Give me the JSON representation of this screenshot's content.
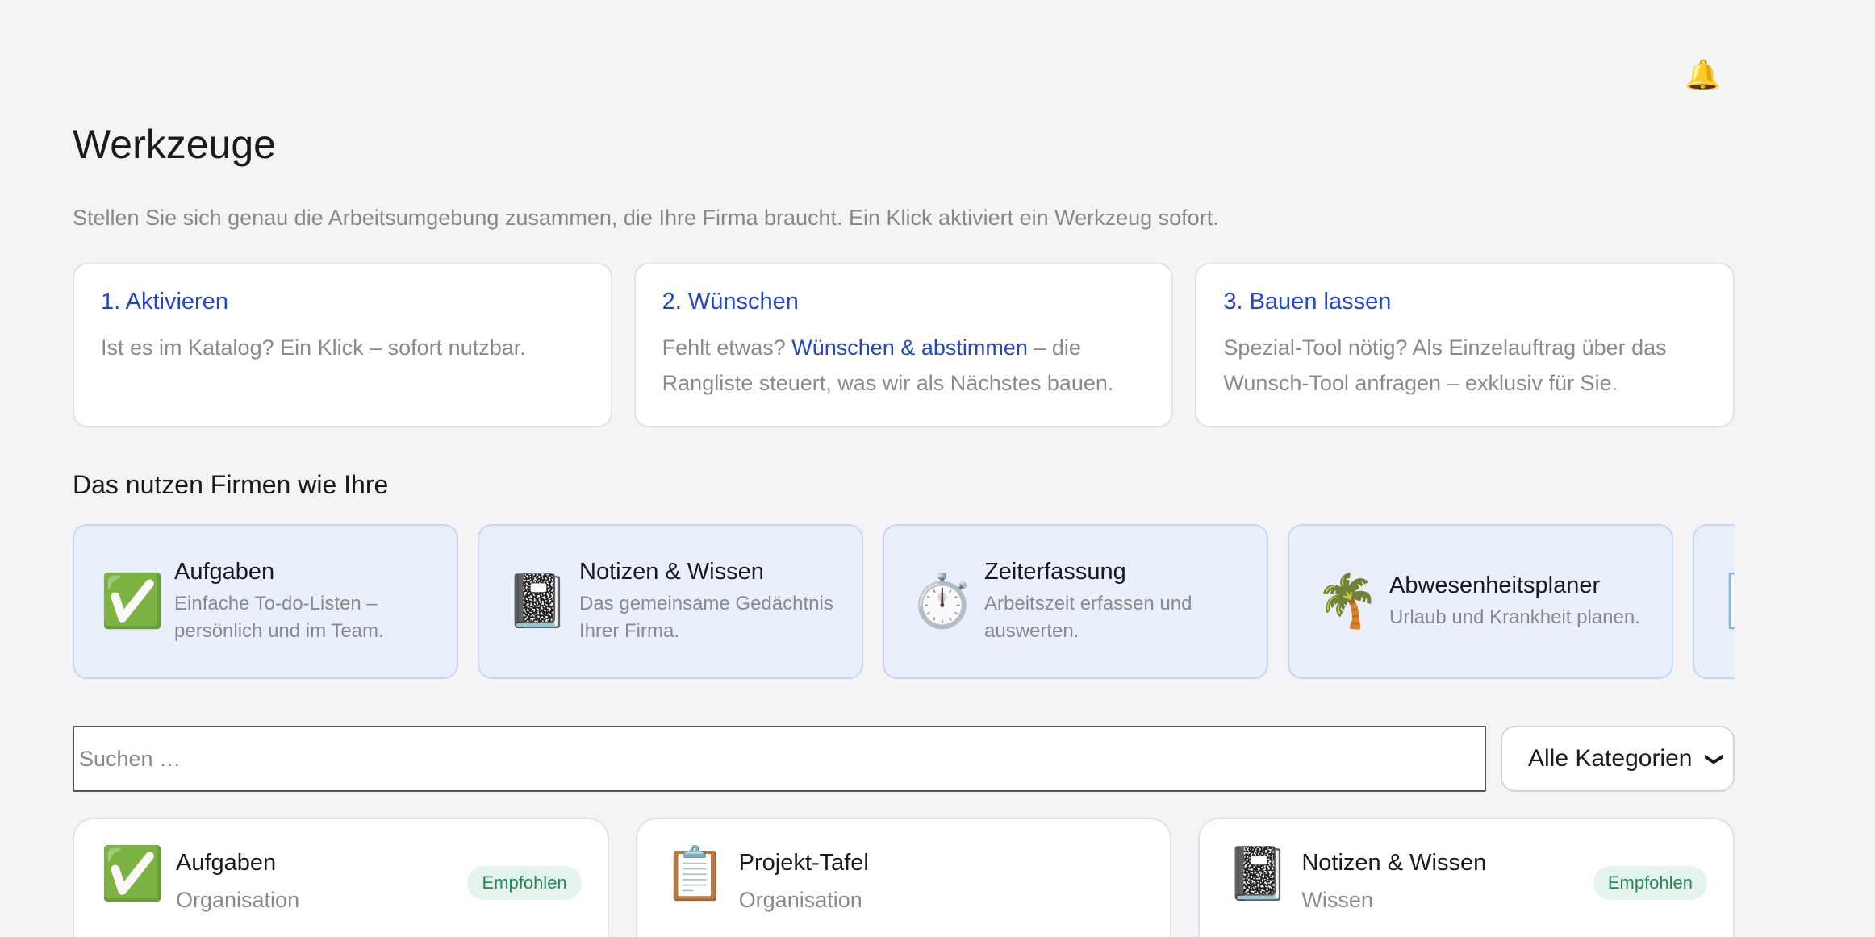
{
  "header": {
    "bell_icon": "🔔"
  },
  "page": {
    "title": "Werkzeuge",
    "subtitle": "Stellen Sie sich genau die Arbeitsumgebung zusammen, die Ihre Firma braucht. Ein Klick aktiviert ein Werkzeug sofort."
  },
  "steps": [
    {
      "title": "1. Aktivieren",
      "text": "Ist es im Katalog? Ein Klick – sofort nutzbar."
    },
    {
      "title": "2. Wünschen",
      "text_before": "Fehlt etwas? ",
      "link": "Wünschen & abstimmen",
      "text_after": " – die Rangliste steuert, was wir als Nächstes bauen."
    },
    {
      "title": "3. Bauen lassen",
      "text": "Spezial-Tool nötig? Als Einzelauftrag über das Wunsch-Tool anfragen – exklusiv für Sie."
    }
  ],
  "popular": {
    "title": "Das nutzen Firmen wie Ihre",
    "items": [
      {
        "icon": "✅",
        "name": "Aufgaben",
        "desc": "Einfache To-do-Listen – persönlich und im Team."
      },
      {
        "icon": "📓",
        "name": "Notizen & Wissen",
        "desc": "Das gemeinsame Gedächtnis Ihrer Firma."
      },
      {
        "icon": "⏱️",
        "name": "Zeiterfassung",
        "desc": "Arbeitszeit erfassen und auswerten."
      },
      {
        "icon": "🌴",
        "name": "Abwesenheitsplaner",
        "desc": "Urlaub und Krankheit planen."
      },
      {
        "icon": "📄",
        "name": "",
        "desc": ""
      }
    ]
  },
  "filters": {
    "search_placeholder": "Suchen …",
    "category_selected": "Alle Kategorien"
  },
  "tools": [
    {
      "icon": "✅",
      "name": "Aufgaben",
      "category": "Organisation",
      "badge": "Empfohlen"
    },
    {
      "icon": "📋",
      "name": "Projekt-Tafel",
      "category": "Organisation",
      "badge": ""
    },
    {
      "icon": "📓",
      "name": "Notizen & Wissen",
      "category": "Wissen",
      "badge": "Empfohlen"
    }
  ],
  "colors": {
    "accent": "#2346c8",
    "badge_green": "#1f8a55",
    "popular_bg": "#eaeffc"
  }
}
